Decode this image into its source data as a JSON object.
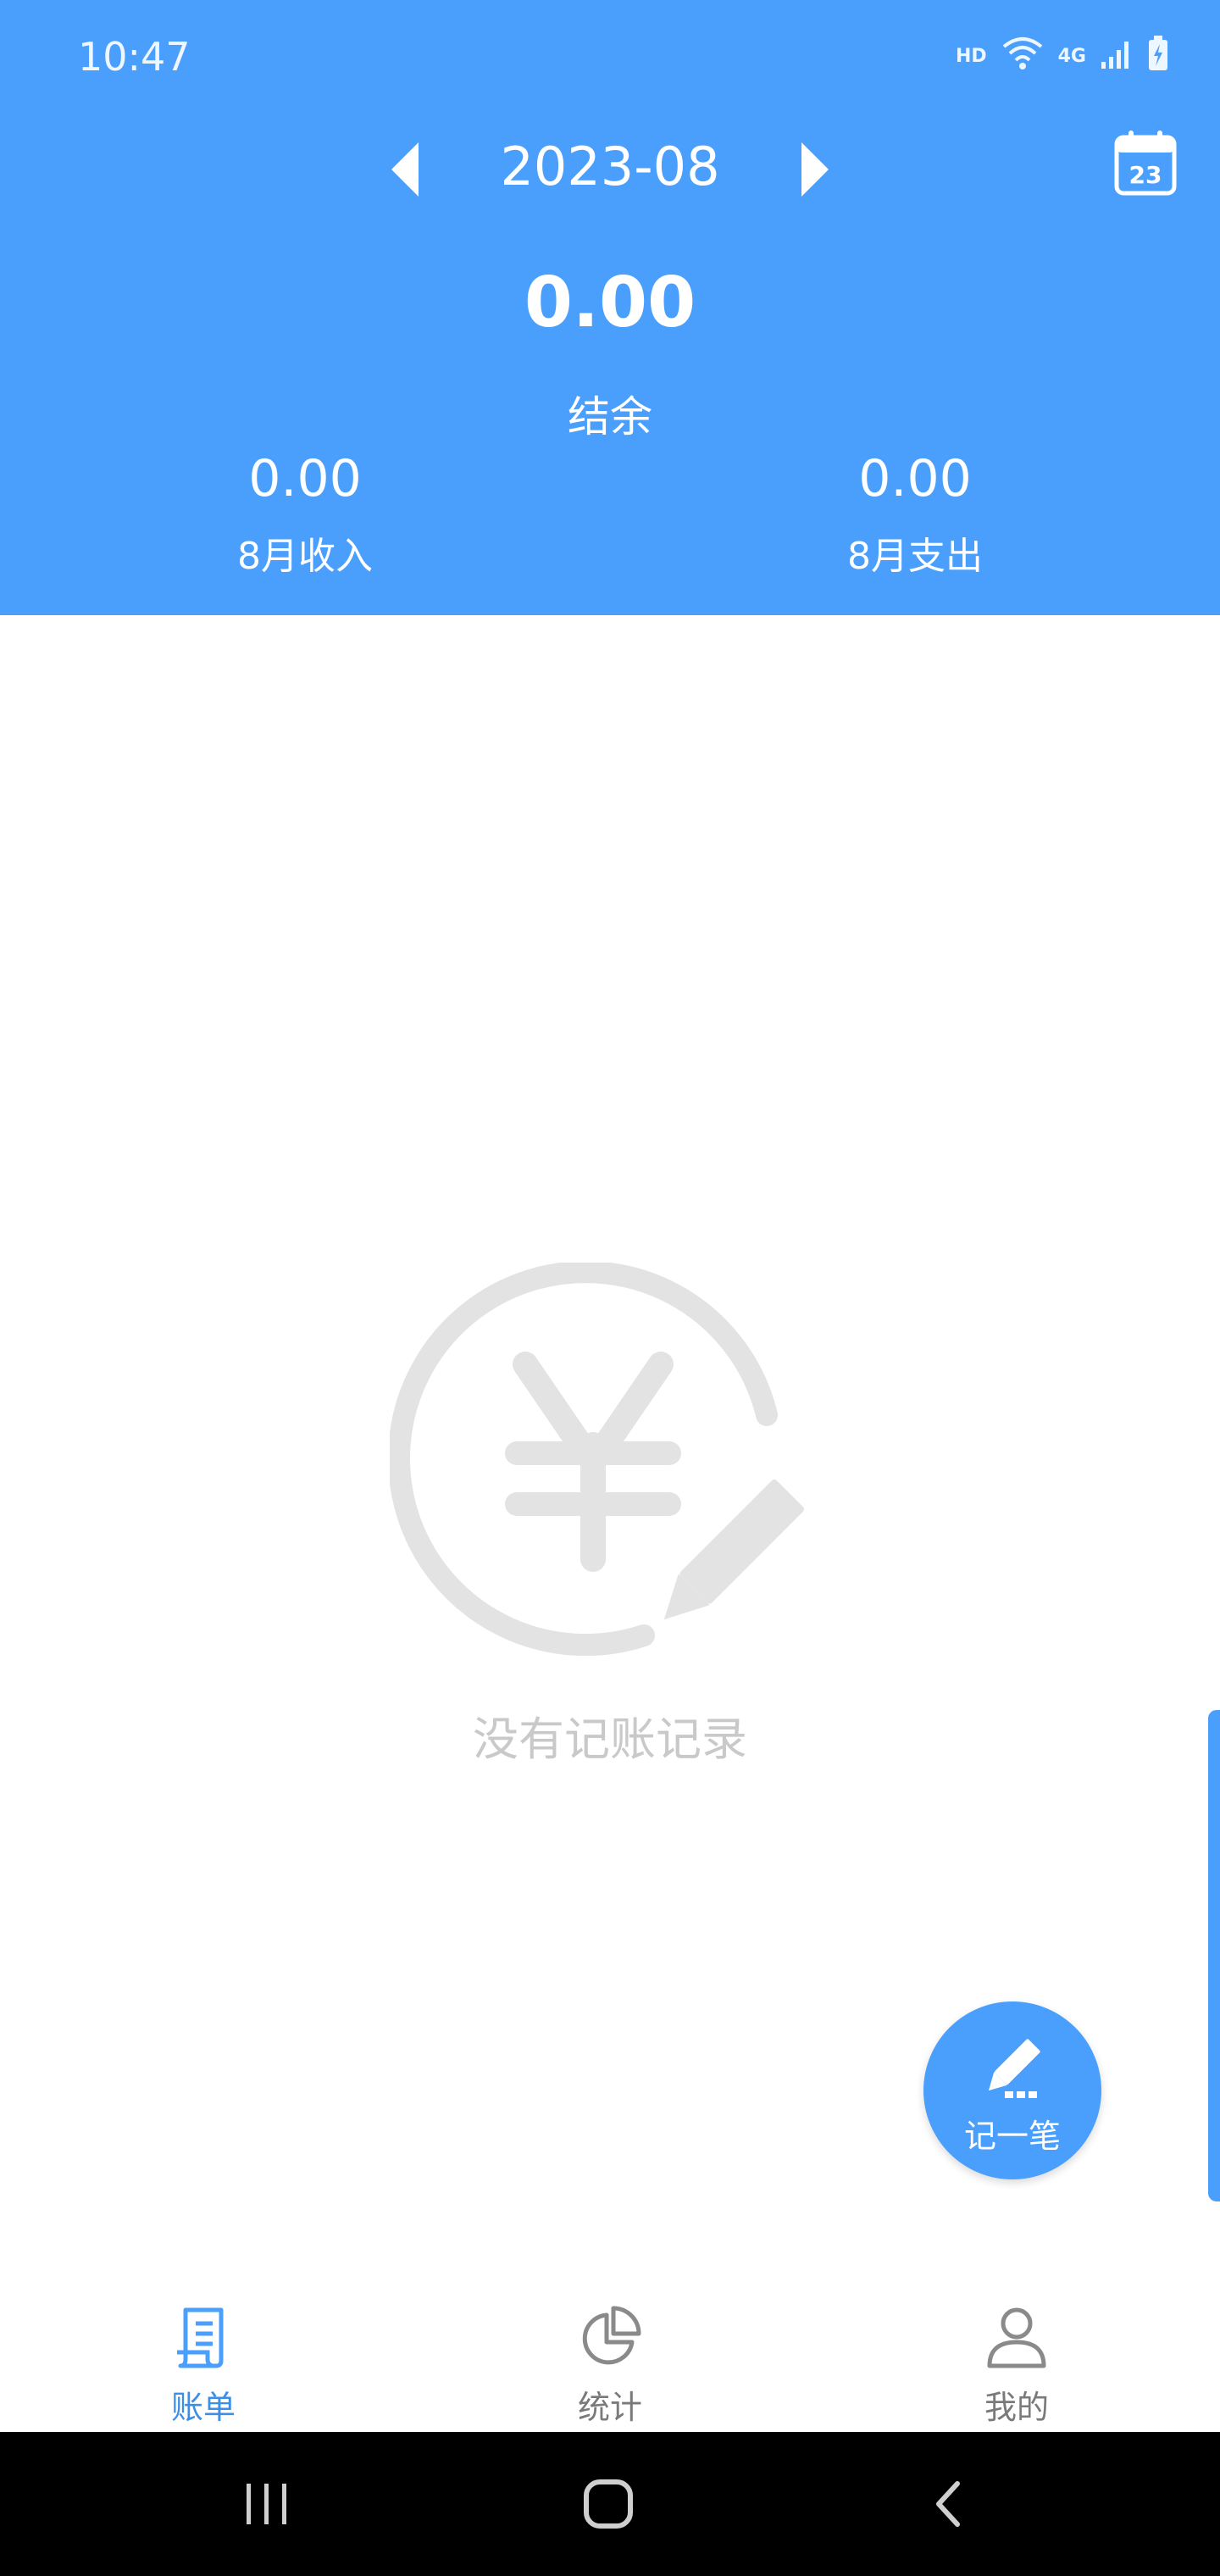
{
  "status_bar": {
    "time": "10:47",
    "hd": "HD",
    "network": "4G"
  },
  "header": {
    "month": "2023-08",
    "calendar_day": "23",
    "balance": "0.00",
    "balance_label": "结余",
    "income_value": "0.00",
    "income_label": "8月收入",
    "expense_value": "0.00",
    "expense_label": "8月支出"
  },
  "empty_state": {
    "message": "没有记账记录"
  },
  "fab": {
    "label": "记一笔"
  },
  "tabs": [
    {
      "label": "账单",
      "icon": "bill-icon",
      "active": true
    },
    {
      "label": "统计",
      "icon": "pie-chart-icon",
      "active": false
    },
    {
      "label": "我的",
      "icon": "user-icon",
      "active": false
    }
  ],
  "colors": {
    "primary": "#4a9ffc",
    "active_tab": "#3b8fe8",
    "muted": "#c9c9c9"
  }
}
